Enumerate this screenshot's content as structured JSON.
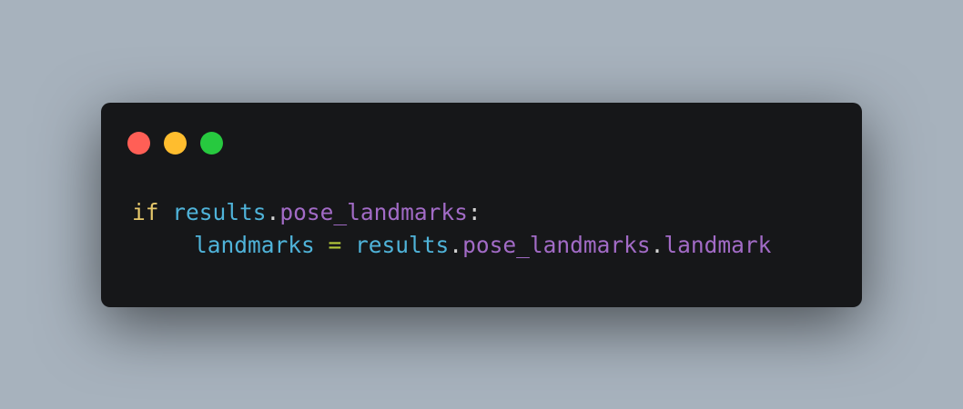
{
  "window": {
    "controls": [
      {
        "name": "close-dot",
        "color": "#ff5f56"
      },
      {
        "name": "minimize-dot",
        "color": "#ffbd2e"
      },
      {
        "name": "maximize-dot",
        "color": "#27c93f"
      }
    ]
  },
  "code": {
    "line1": {
      "keyword": "if",
      "sp": " ",
      "obj": "results",
      "dot": ".",
      "attr": "pose_landmarks",
      "colon": ":"
    },
    "line2": {
      "var": "landmarks",
      "eq": " = ",
      "obj": "results",
      "dot1": ".",
      "attr1": "pose_landmarks",
      "dot2": ".",
      "attr2": "landmark"
    }
  },
  "colors": {
    "background": "#a7b2bd",
    "window": "#161719",
    "keyword": "#e5c76b",
    "identifier": "#4fb3d9",
    "attribute": "#a26bc6",
    "operator": "#b4c93a",
    "punctuation": "#d4d4d4"
  }
}
